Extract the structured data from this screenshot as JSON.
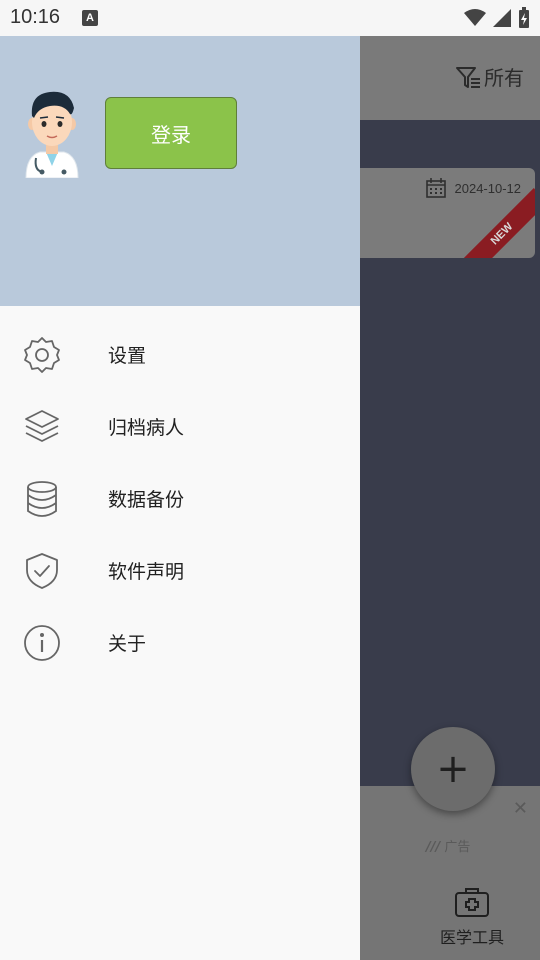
{
  "status_bar": {
    "time": "10:16",
    "notification_letter": "A"
  },
  "app_header": {
    "filter_label": "所有"
  },
  "card": {
    "date": "2024-10-12",
    "badge": "NEW"
  },
  "fab": {
    "symbol": "+"
  },
  "ad": {
    "close_symbol": "✕",
    "tag": "广告"
  },
  "bottom_nav": {
    "tools_label": "医学工具"
  },
  "drawer": {
    "login_label": "登录",
    "menu": [
      {
        "label": "设置",
        "icon": "gear-icon"
      },
      {
        "label": "归档病人",
        "icon": "layers-icon"
      },
      {
        "label": "数据备份",
        "icon": "database-icon"
      },
      {
        "label": "软件声明",
        "icon": "shield-check-icon"
      },
      {
        "label": "关于",
        "icon": "info-icon"
      }
    ]
  },
  "colors": {
    "drawer_header": "#b9c9db",
    "login_button": "#8bc34a",
    "scrim_content": "#393c4b",
    "new_ribbon": "#8a1c22"
  }
}
